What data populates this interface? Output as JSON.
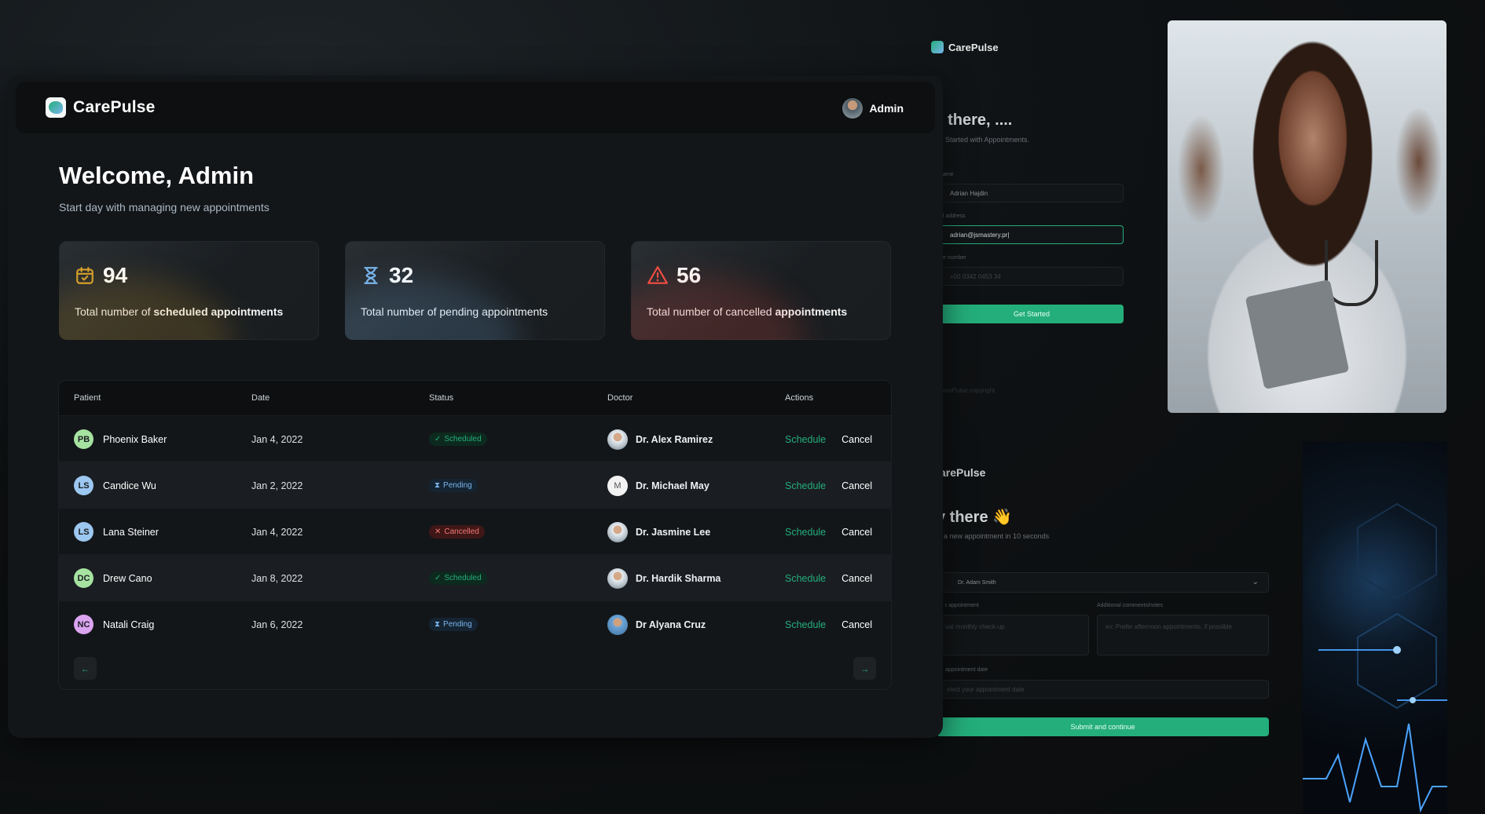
{
  "header": {
    "brand": "CarePulse",
    "user": "Admin"
  },
  "welcome": {
    "title": "Welcome, Admin",
    "subtitle": "Start day with managing new appointments"
  },
  "stats": [
    {
      "count": "94",
      "prefix": "Total number of ",
      "bold": "scheduled appointments",
      "suffix": "",
      "icon": "calendar-check-icon",
      "color": "#d7a02c"
    },
    {
      "count": "32",
      "prefix": "Total number of pending appointments",
      "bold": "",
      "suffix": "",
      "icon": "hourglass-icon",
      "color": "#79b5ec"
    },
    {
      "count": "56",
      "prefix": "Total number of cancelled ",
      "bold": "appointments",
      "suffix": "",
      "icon": "warning-icon",
      "color": "#f24e43"
    }
  ],
  "table": {
    "columns": [
      "Patient",
      "Date",
      "Status",
      "Doctor",
      "Actions"
    ],
    "rows": [
      {
        "initials": "PB",
        "initials_color": "#a6e3a1",
        "patient": "Phoenix Baker",
        "date": "Jan 4, 2022",
        "status": "Scheduled",
        "status_icon": "✓",
        "doctor": "Dr. Alex Ramirez",
        "schedule": "Schedule",
        "cancel": "Cancel"
      },
      {
        "initials": "LS",
        "initials_color": "#9cc7f0",
        "patient": "Candice Wu",
        "date": "Jan 2, 2022",
        "status": "Pending",
        "status_icon": "⧗",
        "doctor": "Dr. Michael May",
        "schedule": "Schedule",
        "cancel": "Cancel"
      },
      {
        "initials": "LS",
        "initials_color": "#9cc7f0",
        "patient": "Lana Steiner",
        "date": "Jan 4, 2022",
        "status": "Cancelled",
        "status_icon": "✕",
        "doctor": "Dr. Jasmine Lee",
        "schedule": "Schedule",
        "cancel": "Cancel"
      },
      {
        "initials": "DC",
        "initials_color": "#a6e3a1",
        "patient": "Drew Cano",
        "date": "Jan 8, 2022",
        "status": "Scheduled",
        "status_icon": "✓",
        "doctor": "Dr. Hardik Sharma",
        "schedule": "Schedule",
        "cancel": "Cancel"
      },
      {
        "initials": "NC",
        "initials_color": "#dba4f0",
        "patient": "Natali Craig",
        "date": "Jan 6, 2022",
        "status": "Pending",
        "status_icon": "⧗",
        "doctor": "Dr Alyana Cruz",
        "schedule": "Schedule",
        "cancel": "Cancel"
      }
    ],
    "doctor_avatar_letter": "M",
    "prev": "←",
    "next": "→"
  },
  "background_signup": {
    "brand": "CarePulse",
    "heading": "i there, ....",
    "sub": "Started with Appointments.",
    "label_name": "ame",
    "name_value": "Adrian Hajdin",
    "label_email": "l address",
    "email_value": "adrian@jsmastery.pr|",
    "label_phone": "e number",
    "phone_placeholder": "+00 0342 0453 34",
    "button": "Get Started",
    "copyright": "arePulse copyright"
  },
  "background_appointment": {
    "brand": "arePulse",
    "heading": "y there 👋",
    "sub": "a new appointment in 10 seconds",
    "doctor": "Dr. Adam Smith",
    "label_reason": "r appointment",
    "reason_placeholder": "ual monthly check-up",
    "label_comments": "Additional comments/notes",
    "comments_placeholder": "ex: Prefer afternoon appointments, if possible",
    "label_date": "appointment date",
    "date_placeholder": "elect your appointment date",
    "button": "Submit and continue"
  }
}
